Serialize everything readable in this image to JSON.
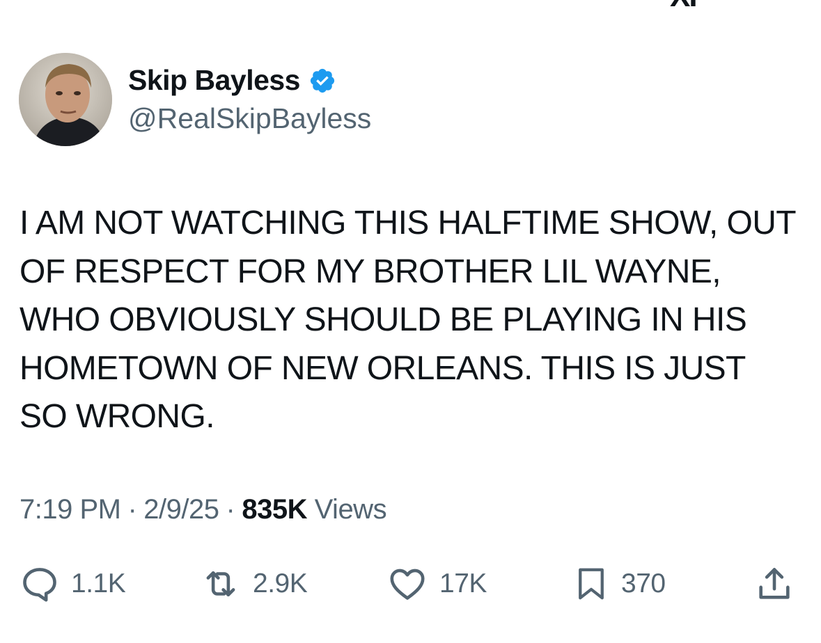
{
  "top_mark": "XI",
  "author": {
    "name": "Skip Bayless",
    "handle": "@RealSkipBayless",
    "verified": true,
    "verified_color": "#1d9bf0"
  },
  "tweet": {
    "text": "I AM NOT WATCHING THIS HALFTIME SHOW, OUT OF RESPECT FOR MY BROTHER LIL WAYNE, WHO OBVIOUSLY SHOULD BE PLAYING IN HIS HOMETOWN OF NEW ORLEANS. THIS IS JUST SO WRONG."
  },
  "meta": {
    "time": "7:19 PM",
    "separator": "·",
    "date": "2/9/25",
    "views_count": "835K",
    "views_label": "Views"
  },
  "actions": {
    "reply": {
      "icon": "reply-icon",
      "count": "1.1K"
    },
    "repost": {
      "icon": "repost-icon",
      "count": "2.9K"
    },
    "like": {
      "icon": "heart-icon",
      "count": "17K"
    },
    "bookmark": {
      "icon": "bookmark-icon",
      "count": "370"
    },
    "share": {
      "icon": "share-icon"
    }
  },
  "colors": {
    "text_primary": "#0f1419",
    "text_secondary": "#536471",
    "background": "#ffffff"
  }
}
